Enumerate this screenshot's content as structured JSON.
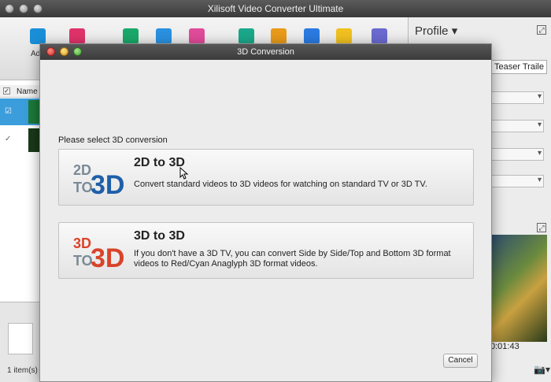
{
  "main_window": {
    "title": "Xilisoft Video Converter Ultimate",
    "toolbar": {
      "add_label": "Ad",
      "icons": [
        {
          "name": "add-icon",
          "color": "#1a8fd8"
        },
        {
          "name": "remove-icon",
          "color": "#e0326a"
        },
        {
          "name": "convert-icon",
          "color": "#1aa86a"
        },
        {
          "name": "pause-icon",
          "color": "#2a90e0"
        },
        {
          "name": "stop-icon",
          "color": "#e04a9a"
        },
        {
          "name": "clip-icon",
          "color": "#1aa88a"
        },
        {
          "name": "file-icon",
          "color": "#e89a1a"
        },
        {
          "name": "3d-icon",
          "color": "#2a7ae0"
        },
        {
          "name": "effect-icon",
          "color": "#f0c020"
        },
        {
          "name": "document-icon",
          "color": "#6a6ad0"
        }
      ]
    },
    "file_list": {
      "header_name": "Name",
      "items_count": "1 item(s)"
    },
    "profile_panel": {
      "title": "Profile",
      "title_field_value": "Teaser Traile",
      "preview_time": "0:01:43"
    }
  },
  "dialog": {
    "title": "3D Conversion",
    "prompt": "Please select 3D conversion",
    "options": [
      {
        "title": "2D to 3D",
        "description": "Convert standard videos to 3D videos for watching on standard TV or 3D TV.",
        "logo_text_top": "2D",
        "logo_text_bottom": "TO",
        "logo_big": "3D"
      },
      {
        "title": "3D to 3D",
        "description": "If you don't have a 3D TV, you can convert Side by Side/Top and Bottom 3D format videos to Red/Cyan Anaglyph 3D format videos.",
        "logo_text_top": "3D",
        "logo_text_bottom": "TO",
        "logo_big": "3D"
      }
    ],
    "cancel_label": "Cancel"
  },
  "colors": {
    "selection": "#3b9ddb",
    "logo_blue": "#1e5fa8",
    "logo_red": "#d8442a",
    "logo_gray": "#7b8a97"
  }
}
